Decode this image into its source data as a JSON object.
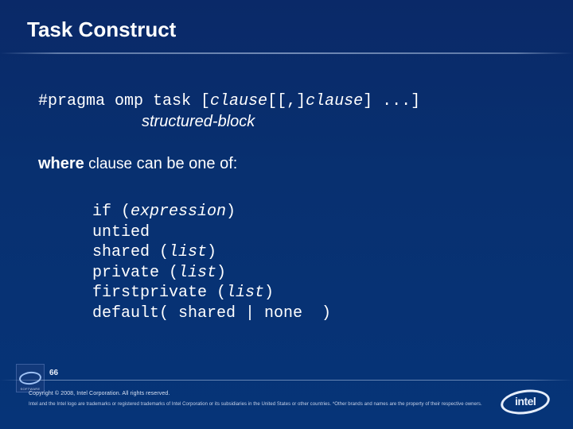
{
  "title": "Task Construct",
  "pragma": {
    "prefix": "#pragma omp task [",
    "clause1": "clause",
    "mid": "[[,]",
    "clause2": "clause",
    "suffix": "] ...]"
  },
  "structured_block": "structured-block",
  "where": {
    "bold": "where",
    "clause_word": " clause",
    "rest": " can be one of:"
  },
  "clauses": {
    "l1a": "if (",
    "l1b": "expression",
    "l1c": ")",
    "l2": "untied",
    "l3a": "shared (",
    "l3b": "list",
    "l3c": ")",
    "l4a": "private (",
    "l4b": "list",
    "l4c": ")",
    "l5a": "firstprivate (",
    "l5b": "list",
    "l5c": ")",
    "l6": "default( shared | none  )"
  },
  "footer": {
    "slide_number": "66",
    "copyright": "Copyright © 2008, Intel Corporation. All rights reserved.",
    "trademark": "Intel and the Intel logo are trademarks or registered trademarks of Intel Corporation or its subsidiaries in the United States or other countries. *Other brands and names are the property of their respective owners.",
    "logo_text": "intel",
    "logo_small_sub": "SOFTWARE"
  }
}
